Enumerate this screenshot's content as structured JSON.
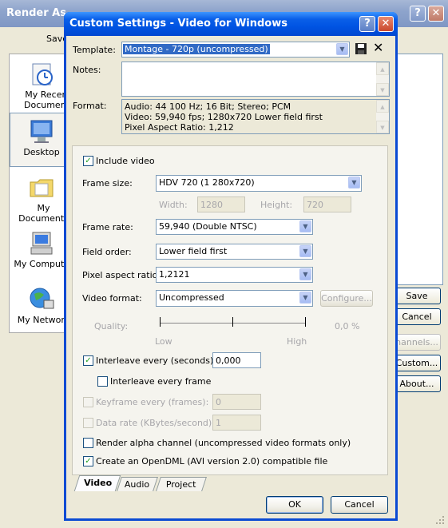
{
  "background_window": {
    "title": "Render As",
    "save_label": "Save",
    "places": [
      {
        "label": "My Recent Documents",
        "icon": "recent-documents-icon"
      },
      {
        "label": "Desktop",
        "icon": "desktop-icon"
      },
      {
        "label": "My Documents",
        "icon": "folder-icon"
      },
      {
        "label": "My Computer",
        "icon": "computer-icon"
      },
      {
        "label": "My Network",
        "icon": "network-icon"
      }
    ],
    "buttons": {
      "save": "Save",
      "cancel": "Cancel",
      "channels": "hannels...",
      "custom": "Custom...",
      "about": "About..."
    }
  },
  "dialog": {
    "title": "Custom Settings - Video for Windows",
    "help_glyph": "?",
    "close_glyph": "✕",
    "template_label": "Template:",
    "template_value": "Montage - 720p (uncompressed)",
    "save_template_icon": "floppy-disk-icon",
    "delete_template_glyph": "✕",
    "notes_label": "Notes:",
    "notes_value": "",
    "format_label": "Format:",
    "format_lines": [
      "Audio: 44 100 Hz; 16 Bit; Stereo; PCM",
      "Video: 59,940 fps; 1280x720 Lower field first",
      "Pixel Aspect Ratio: 1,212"
    ],
    "include_video_label": "Include video",
    "include_video_checked": true,
    "frame_size_label": "Frame size:",
    "frame_size_value": "HDV 720 (1 280x720)",
    "width_label": "Width:",
    "width_value": "1280",
    "height_label": "Height:",
    "height_value": "720",
    "frame_rate_label": "Frame rate:",
    "frame_rate_value": "59,940 (Double NTSC)",
    "field_order_label": "Field order:",
    "field_order_value": "Lower field first",
    "par_label": "Pixel aspect ratio:",
    "par_value": "1,2121",
    "video_format_label": "Video format:",
    "video_format_value": "Uncompressed",
    "configure_label": "Configure...",
    "quality_label": "Quality:",
    "quality_low": "Low",
    "quality_high": "High",
    "quality_value": "0,0 %",
    "interleave_label": "Interleave every (seconds):",
    "interleave_checked": true,
    "interleave_value": "0,000",
    "interleave_frame_label": "Interleave every frame",
    "interleave_frame_checked": false,
    "keyframe_label": "Keyframe every (frames):",
    "keyframe_value": "0",
    "datarate_label": "Data rate (KBytes/second):",
    "datarate_value": "1",
    "alpha_label": "Render alpha channel (uncompressed video formats only)",
    "alpha_checked": false,
    "opendml_label": "Create an OpenDML (AVI version 2.0) compatible file",
    "opendml_checked": true,
    "tabs": [
      "Video",
      "Audio",
      "Project"
    ],
    "active_tab": "Video",
    "ok_label": "OK",
    "cancel_label": "Cancel",
    "check_glyph": "✓"
  },
  "colors": {
    "title_blue": "#0054e3",
    "dialog_bg": "#ece9d8",
    "check_green": "#21a121"
  }
}
